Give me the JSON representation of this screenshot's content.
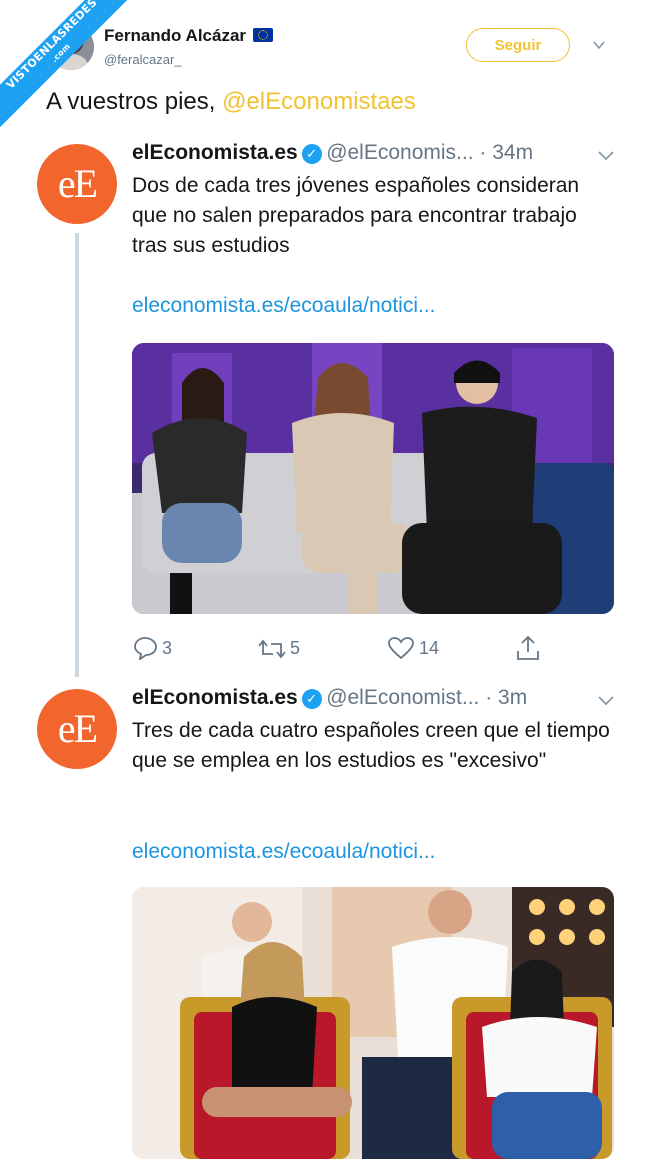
{
  "watermark": {
    "line1": "VISTOENLASREDES",
    "line2": ".com"
  },
  "author": {
    "name": "Fernando Alcázar",
    "handle": "@feralcazar_",
    "flag_icon": "eu-flag-icon"
  },
  "follow_label": "Seguir",
  "tweet": {
    "text_prefix": "A vuestros pies, ",
    "mention": "@elEconomistaes"
  },
  "quoted": [
    {
      "logo_text": "eE",
      "name": "elEconomista.es",
      "handle_time": "@elEconomis... · 34m",
      "body": "Dos de cada tres jóvenes españoles consideran que no salen preparados para encontrar trabajo tras sus estudios",
      "link": "eleconomista.es/ecoaula/notici...",
      "replies": "3",
      "retweets": "5",
      "likes": "14"
    },
    {
      "logo_text": "eE",
      "name": "elEconomista.es",
      "handle_time": "@elEconomist... · 3m",
      "body": "Tres de cada cuatro españoles creen que el tiempo que se emplea en los estudios es \"excesivo\"",
      "link": "eleconomista.es/ecoaula/notici..."
    }
  ],
  "colors": {
    "accent": "#f1c232",
    "link": "#1b95e0",
    "logo": "#f2662d",
    "verified": "#1da1f2"
  }
}
